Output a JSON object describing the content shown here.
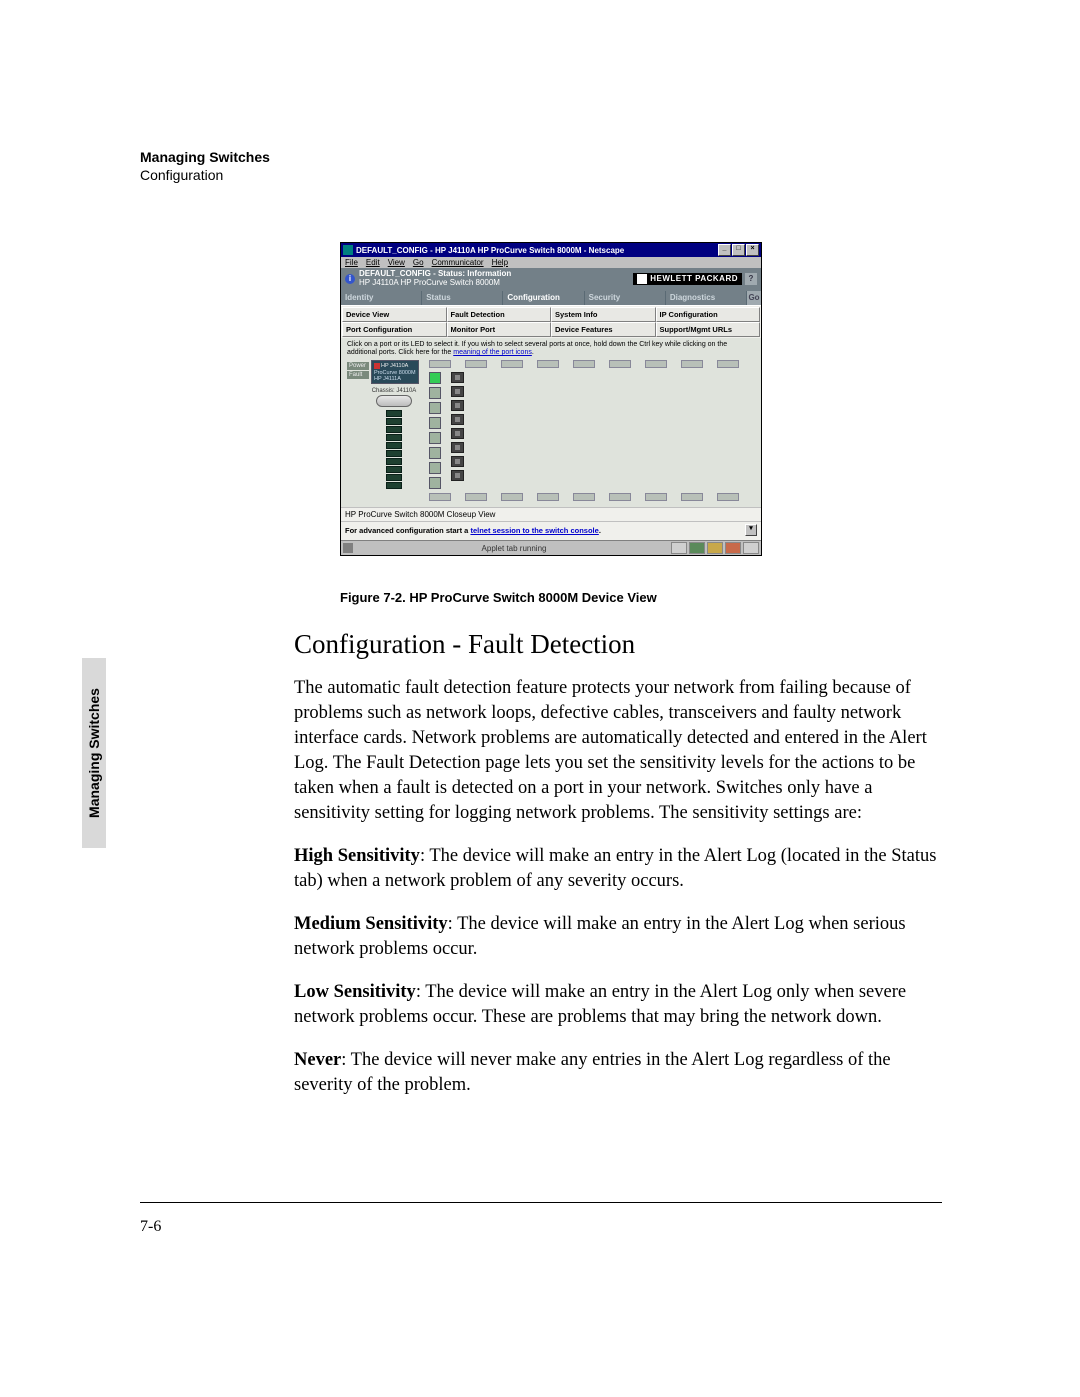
{
  "running_head": {
    "bold": "Managing Switches",
    "plain": "Configuration"
  },
  "side_tab": "Managing Switches",
  "browser": {
    "title": "DEFAULT_CONFIG - HP J4110A HP ProCurve Switch 8000M - Netscape",
    "sys": {
      "min": "_",
      "max": "□",
      "close": "×"
    },
    "menu": [
      "File",
      "Edit",
      "View",
      "Go",
      "Communicator",
      "Help"
    ],
    "info": {
      "line1": "DEFAULT_CONFIG - Status: Information",
      "line2": "HP J4110A HP ProCurve Switch 8000M",
      "brand": "HEWLETT PACKARD",
      "q": "?"
    },
    "tabs": [
      "Identity",
      "Status",
      "Configuration",
      "Security",
      "Diagnostics"
    ],
    "go": "Go",
    "buttons_row1": [
      "Device View",
      "Fault Detection",
      "System Info",
      "IP Configuration"
    ],
    "buttons_row2": [
      "Port Configuration",
      "Monitor Port",
      "Device Features",
      "Support/Mgmt URLs"
    ],
    "instruction_pre": "Click on a port or its LED to select it. If you wish to select several ports at once, hold down the Ctrl key while clicking on the additional ports. Click here for the ",
    "instruction_link": "meaning of the port icons",
    "left_labels": [
      "Power",
      "Fault"
    ],
    "module": {
      "name1": "HP J4110A",
      "name2": "ProCurve 8000M",
      "name3": "HP J4111A"
    },
    "chassis_label": "Chassis: J4110A",
    "caption": "HP ProCurve Switch 8000M Closeup View",
    "telnet_pre": "For advanced configuration start a ",
    "telnet_link": "telnet session to the switch console",
    "status": "Applet tab running"
  },
  "figure_caption": "Figure 7-2.   HP ProCurve Switch 8000M Device View",
  "section_heading": "Configuration - Fault Detection",
  "para1": "The automatic fault detection feature protects your network from failing because of problems such as network loops, defective cables, transceivers and faulty network interface cards. Network problems are automatically detected and entered in the Alert Log. The Fault Detection page lets you set the sensitivity levels for the actions to be taken when a fault is detected on a port in your network. Switches only have a sensitivity setting for logging network problems. The sensitivity settings are:",
  "hi_lead": "High Sensitivity",
  "hi_body": ": The device will make an entry in the Alert Log (located in the Status tab) when a network problem of any severity occurs.",
  "med_lead": "Medium Sensitivity",
  "med_body": ": The device will make an entry in the Alert Log when serious network problems occur.",
  "low_lead": "Low Sensitivity",
  "low_body": ": The device will make an entry in the Alert Log only when severe network problems occur. These are problems that may bring the network down.",
  "nev_lead": "Never",
  "nev_body": ": The device will never make any entries in the Alert Log regardless of the severity of the problem.",
  "page_number": "7-6"
}
